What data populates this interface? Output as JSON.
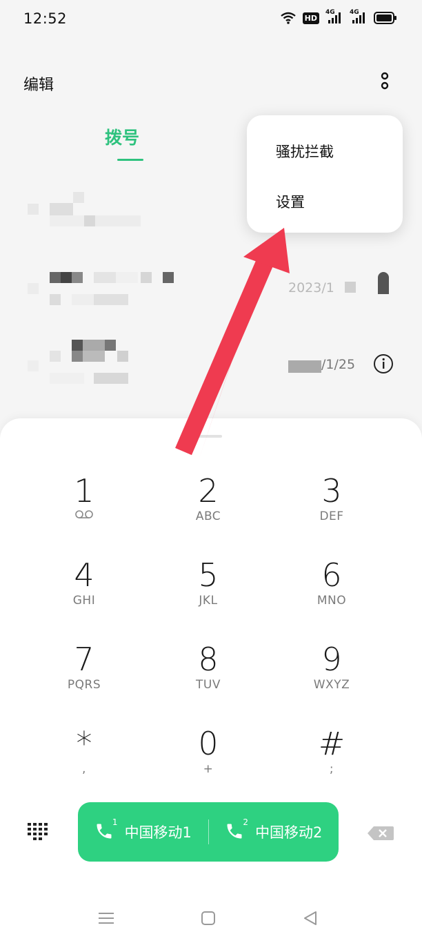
{
  "status_bar": {
    "time": "12:52",
    "hd_label": "HD",
    "net1": "4G",
    "net2": "4G"
  },
  "header": {
    "edit_label": "编辑"
  },
  "tabs": {
    "dial_label": "拨号"
  },
  "call_log": {
    "row2_date": "2023/1",
    "row3_date": "/1/25"
  },
  "menu": {
    "items": [
      "骚扰拦截",
      "设置"
    ]
  },
  "dialpad": {
    "keys": [
      {
        "digit": "1",
        "letters": ""
      },
      {
        "digit": "2",
        "letters": "ABC"
      },
      {
        "digit": "3",
        "letters": "DEF"
      },
      {
        "digit": "4",
        "letters": "GHI"
      },
      {
        "digit": "5",
        "letters": "JKL"
      },
      {
        "digit": "6",
        "letters": "MNO"
      },
      {
        "digit": "7",
        "letters": "PQRS"
      },
      {
        "digit": "8",
        "letters": "TUV"
      },
      {
        "digit": "9",
        "letters": "WXYZ"
      },
      {
        "digit": "*",
        "letters": ","
      },
      {
        "digit": "0",
        "letters": "+"
      },
      {
        "digit": "#",
        "letters": ";"
      }
    ],
    "sim1": {
      "label": "中国移动1",
      "number": "1"
    },
    "sim2": {
      "label": "中国移动2",
      "number": "2"
    }
  },
  "colors": {
    "accent": "#2ec27e",
    "call_button": "#2ed181",
    "annotation_arrow": "#ef3b50"
  },
  "icons": [
    "wifi-icon",
    "hd-icon",
    "signal-icon",
    "battery-icon",
    "more-icon",
    "info-icon",
    "voicemail-icon",
    "dialpad-grid-icon",
    "phone-icon",
    "backspace-icon",
    "menu-icon",
    "home-icon",
    "back-icon",
    "annotation-arrow"
  ]
}
